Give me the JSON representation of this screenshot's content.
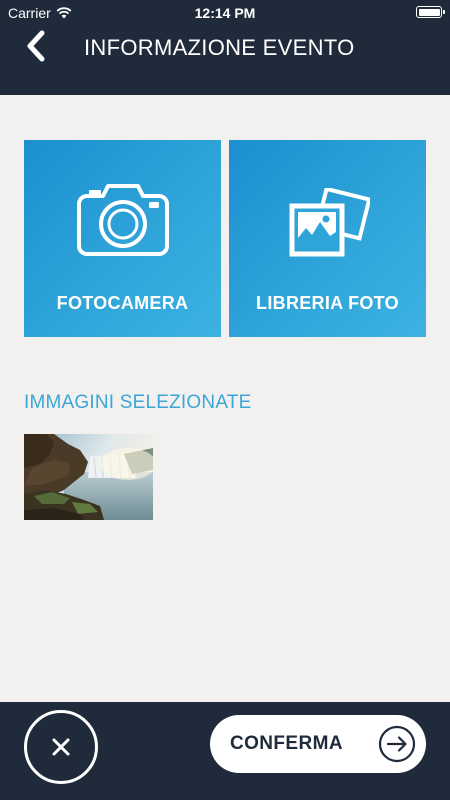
{
  "status_bar": {
    "carrier": "Carrier",
    "time": "12:14 PM",
    "wifi_icon": "wifi-icon",
    "battery_icon": "battery-icon"
  },
  "nav": {
    "back_icon": "chevron-left-icon",
    "title": "INFORMAZIONE EVENTO"
  },
  "tiles": [
    {
      "icon": "camera-icon",
      "label": "FOTOCAMERA"
    },
    {
      "icon": "photo-library-icon",
      "label": "LIBRERIA FOTO"
    }
  ],
  "selected_images": {
    "title": "IMMAGINI SELEZIONATE",
    "count": 1
  },
  "bottom_bar": {
    "cancel_icon": "close-icon",
    "confirm_label": "CONFERMA",
    "confirm_icon": "arrow-right-circle-icon"
  },
  "colors": {
    "header_bg": "#1f2b3a",
    "tile_blue": "#2ea4d9",
    "section_title": "#3aa6d7",
    "content_bg": "#f3f1ef"
  }
}
